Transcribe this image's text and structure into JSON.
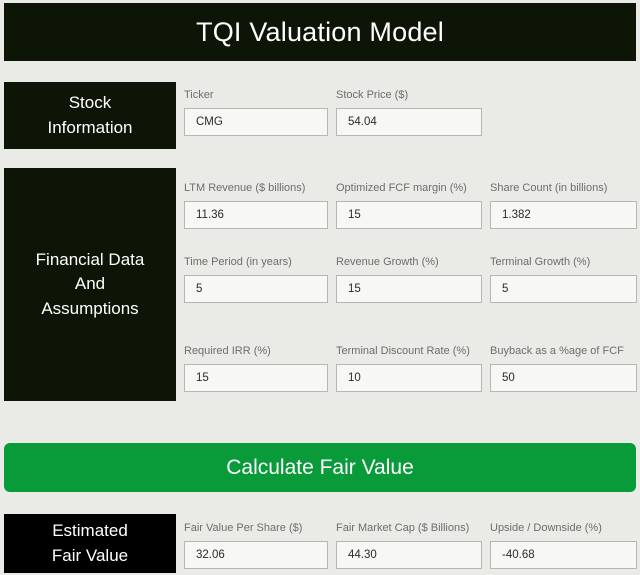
{
  "app": {
    "title": "TQI Valuation Model",
    "colors": {
      "header_dark": "#0d1606",
      "header_black": "#000000",
      "accent_green": "#099a3a",
      "background": "#eaeae6",
      "label_gray": "#6d6d6d",
      "input_border": "#b7b7b2",
      "input_fill": "#f7f7f5"
    }
  },
  "sections": {
    "stock": {
      "heading_line1": "Stock",
      "heading_line2": "Information",
      "fields": [
        {
          "label": "Ticker",
          "value": "CMG"
        },
        {
          "label": "Stock Price ($)",
          "value": "54.04"
        }
      ]
    },
    "financial": {
      "heading_line1": "Financial Data",
      "heading_line2": "And",
      "heading_line3": "Assumptions",
      "row1": [
        {
          "label": "LTM Revenue ($ billions)",
          "value": "11.36"
        },
        {
          "label": "Optimized FCF margin (%)",
          "value": "15"
        },
        {
          "label": "Share Count (in billions)",
          "value": "1.382"
        }
      ],
      "row2": [
        {
          "label": "Time Period (in years)",
          "value": "5"
        },
        {
          "label": "Revenue Growth (%)",
          "value": "15"
        },
        {
          "label": "Terminal Growth (%)",
          "value": "5"
        }
      ],
      "row3": [
        {
          "label": "Required IRR (%)",
          "value": "15"
        },
        {
          "label": "Terminal Discount Rate (%)",
          "value": "10"
        },
        {
          "label": "Buyback as a %age of FCF",
          "value": "50"
        }
      ]
    },
    "estimated": {
      "heading_line1": "Estimated",
      "heading_line2": "Fair Value",
      "fields": [
        {
          "label": "Fair Value Per Share ($)",
          "value": "32.06"
        },
        {
          "label": "Fair Market Cap ($ Billions)",
          "value": "44.30"
        },
        {
          "label": "Upside / Downside (%)",
          "value": "-40.68"
        }
      ]
    }
  },
  "actions": {
    "calculate_label": "Calculate Fair Value"
  }
}
